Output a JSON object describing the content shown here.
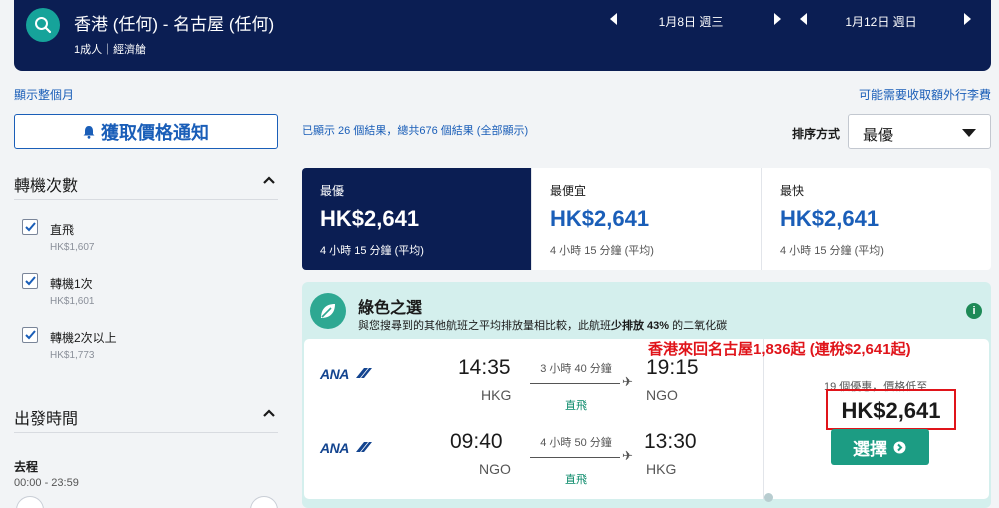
{
  "header": {
    "route": "香港 (任何) - 名古屋 (任何)",
    "passengers": "1成人｜經濟艙",
    "depart_date": "1月8日 週三",
    "return_date": "1月12日 週日"
  },
  "links": {
    "show_month": "顯示整個月",
    "baggage_fee": "可能需要收取額外行李費"
  },
  "price_alert": {
    "label": "獲取價格通知"
  },
  "filters": {
    "stops_title": "轉機次數",
    "stops": [
      {
        "label": "直飛",
        "price": "HK$1,607",
        "checked": true
      },
      {
        "label": "轉機1次",
        "price": "HK$1,601",
        "checked": true
      },
      {
        "label": "轉機2次以上",
        "price": "HK$1,773",
        "checked": true
      }
    ],
    "departure_title": "出發時間",
    "outbound_label": "去程",
    "outbound_range": "00:00 - 23:59"
  },
  "results": {
    "count_text": "已顯示 26 個結果，總共676 個結果 (全部顯示)",
    "sort_label": "排序方式",
    "sort_value": "最優"
  },
  "tabs": [
    {
      "label": "最優",
      "price": "HK$2,641",
      "duration": "4 小時 15 分鐘 (平均)"
    },
    {
      "label": "最便宜",
      "price": "HK$2,641",
      "duration": "4 小時 15 分鐘 (平均)"
    },
    {
      "label": "最快",
      "price": "HK$2,641",
      "duration": "4 小時 15 分鐘 (平均)"
    }
  ],
  "green": {
    "title": "綠色之選",
    "desc_prefix": "與您搜尋到的其他航班之平均排放量相比較，此航班",
    "desc_bold": "少排放 43%",
    "desc_suffix": " 的二氧化碳",
    "info": "i"
  },
  "flight": {
    "annotation": "香港來回名古屋1,836起 (連稅$2,641起)",
    "legs": [
      {
        "airline": "ANA",
        "dep_time": "14:35",
        "dep_code": "HKG",
        "duration": "3 小時 40 分鐘",
        "stops": "直飛",
        "arr_time": "19:15",
        "arr_code": "NGO"
      },
      {
        "airline": "ANA",
        "dep_time": "09:40",
        "dep_code": "NGO",
        "duration": "4 小時 50 分鐘",
        "stops": "直飛",
        "arr_time": "13:30",
        "arr_code": "HKG"
      }
    ],
    "deals_text": "19 個優惠，價格低至",
    "price": "HK$2,641",
    "select_label": "選擇"
  },
  "colors": {
    "navy": "#0b1e53",
    "teal": "#1c9c83",
    "blue_link": "#1a5eb8",
    "annotation_red": "#e0141a"
  }
}
